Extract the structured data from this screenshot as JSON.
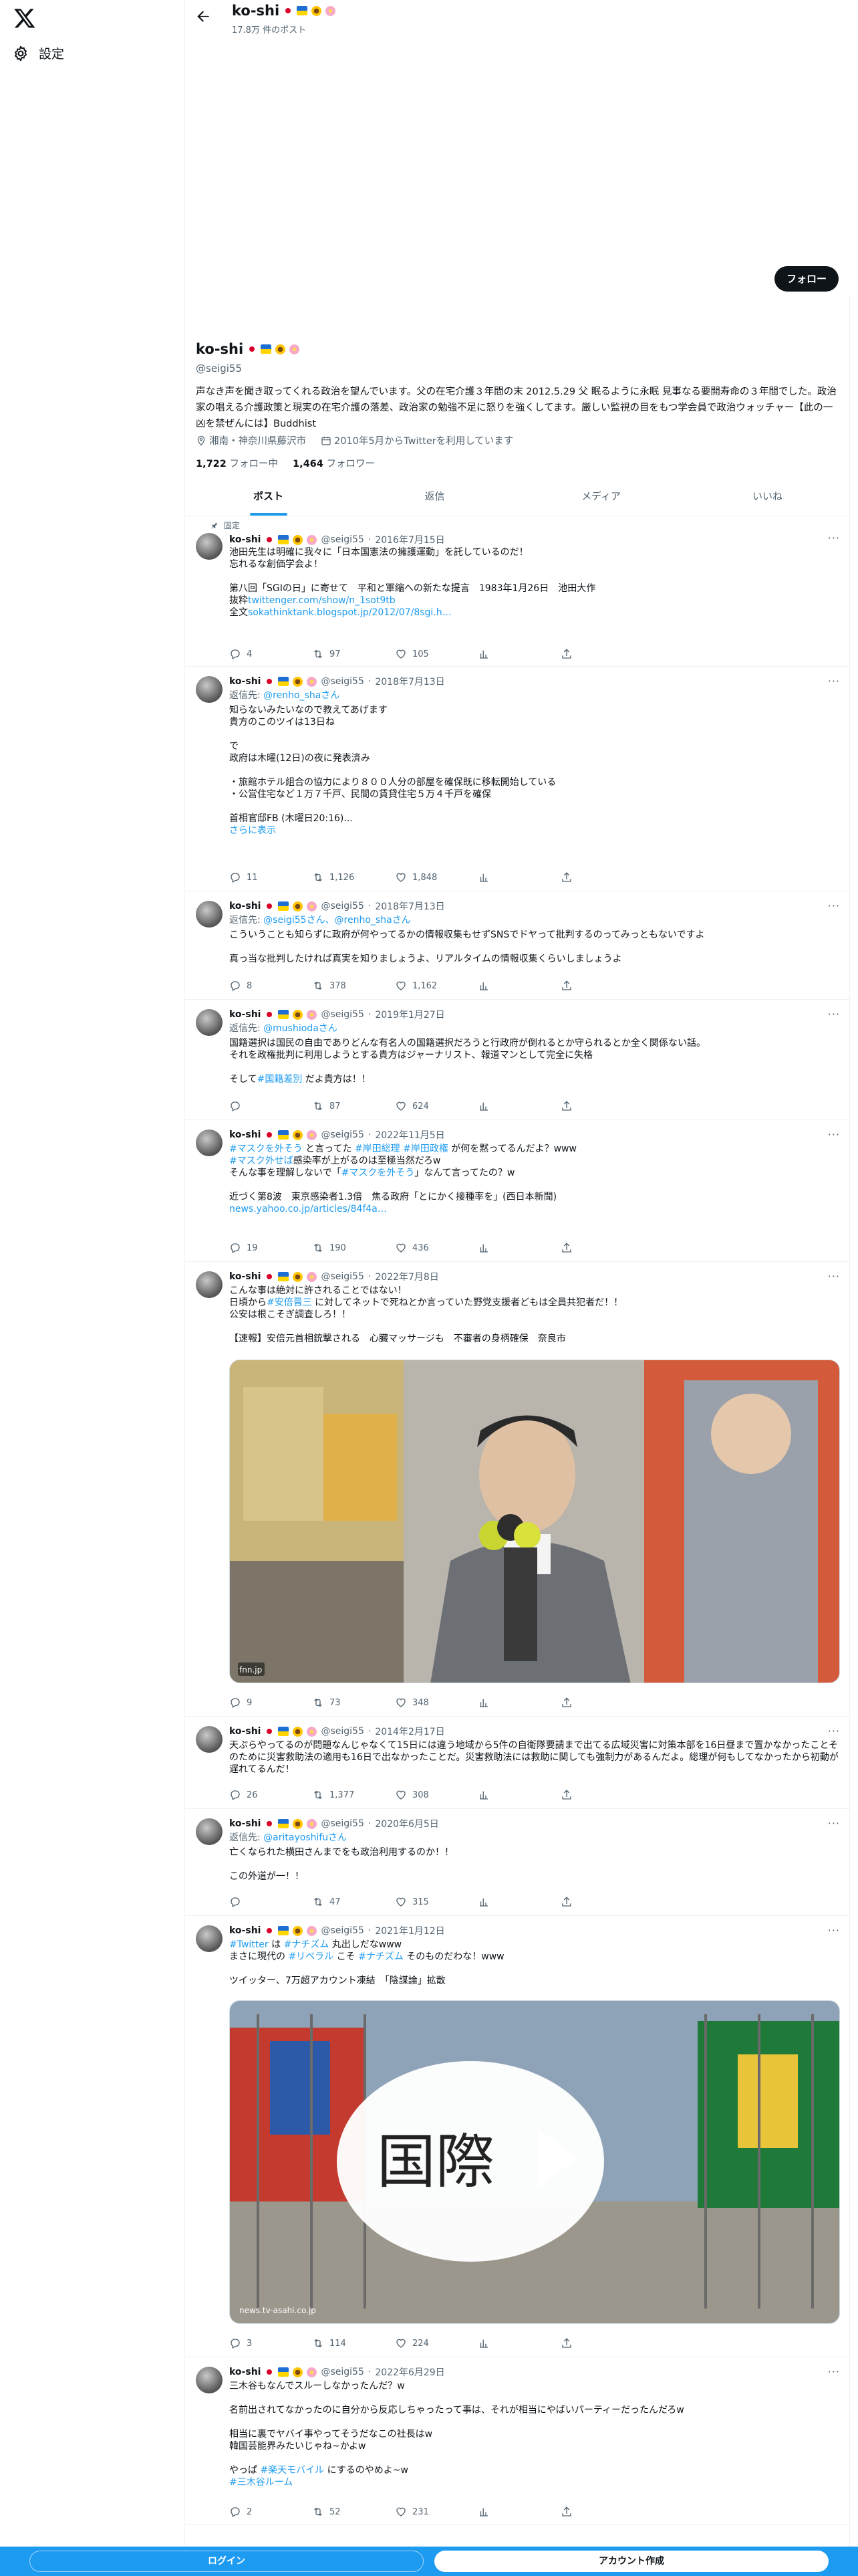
{
  "nav": {
    "settings_label": "設定"
  },
  "header": {
    "name": "ko-shi",
    "post_count": "17.8万 件のポスト"
  },
  "profile": {
    "name": "ko-shi",
    "handle": "@seigi55",
    "follow_label": "フォロー",
    "bio": "声なき声を聞き取ってくれる政治を望んでいます。父の在宅介護３年間の末 2012.5.29 父 眠るように永眠 見事なる要開寿命の３年間でした。政治家の唱える介護政策と現実の在宅介護の落差、政治家の勉強不足に怒りを強くしてます。厳しい監視の目をもつ学会員で政治ウォッチャー【此の一凶を禁ぜんには】Buddhist",
    "location": "湘南・神奈川県藤沢市",
    "joined": "2010年5月からTwitterを利用しています",
    "following_count": "1,722",
    "following_label": "フォロー中",
    "followers_count": "1,464",
    "followers_label": "フォロワー"
  },
  "tabs": [
    "ポスト",
    "返信",
    "メディア",
    "いいね"
  ],
  "tweets": [
    {
      "pinned_label": "固定",
      "name": "ko-shi",
      "handle": "@seigi55",
      "date": "2016年7月15日",
      "reply_to": "",
      "reply_users": "",
      "text": "池田先生は明確に我々に「日本国憲法の擁護運動」を託しているのだ！\n忘れるな創価学会よ！\n\n第八回「SGIの日」に寄せて　平和と軍縮への新たな提言　1983年1月26日　池田大作\n抜粋",
      "links": [
        "twittenger.com/show/n_1sot9tb",
        "全文",
        "sokathinktank.blogspot.jp/2012/07/8sgi.h…"
      ],
      "replies": "4",
      "retweets": "97",
      "likes": "105"
    },
    {
      "name": "ko-shi",
      "handle": "@seigi55",
      "date": "2018年7月13日",
      "reply_to": "返信先: ",
      "reply_users": "@renho_shaさん",
      "text": "知らないみたいなので教えてあげます\n貴方のこのツイは13日ね\n\nで\n政府は木曜(12日)の夜に発表済み\n\n・旅館ホテル組合の協力により８００人分の部屋を確保既に移転開始している\n・公営住宅など１万７千戸、民間の賃貸住宅５万４千戸を確保\n\n首相官邸FB (木曜日20:16)...",
      "more_label": "さらに表示",
      "replies": "11",
      "retweets": "1,126",
      "likes": "1,848"
    },
    {
      "name": "ko-shi",
      "handle": "@seigi55",
      "date": "2018年7月13日",
      "reply_to": "返信先: ",
      "reply_users": "@seigi55さん、@renho_shaさん",
      "text": "こういうことも知らずに政府が何やってるかの情報収集もせずSNSでドヤって批判するのってみっともないですよ\n\n真っ当な批判したければ真実を知りましょうよ、リアルタイムの情報収集くらいしましょうよ",
      "replies": "8",
      "retweets": "378",
      "likes": "1,162"
    },
    {
      "name": "ko-shi",
      "handle": "@seigi55",
      "date": "2019年1月27日",
      "reply_to": "返信先: ",
      "reply_users": "@mushiodaさん",
      "text": "国籍選択は国民の自由でありどんな有名人の国籍選択だろうと行政府が倒れるとか守られるとか全く関係ない話。\nそれを政権批判に利用しようとする貴方はジャーナリスト、報道マンとして完全に失格\n\nそして",
      "hashtag": "#国籍差別",
      "text_after": " だよ貴方は！！",
      "replies": "",
      "retweets": "87",
      "likes": "624"
    },
    {
      "name": "ko-shi",
      "handle": "@seigi55",
      "date": "2022年11月5日",
      "reply_to": "",
      "reply_users": "",
      "text_rich": "#マスクを外そう と言ってた #岸田総理 #岸田政権 が何を黙ってるんだよ？www\n#マスク外せば感染率が上がるのは至極当然だろw\nそんな事を理解しないで「#マスクを外そう」なんて言ってたの？w\n\n近づく第8波　東京感染者1.3倍　焦る政府「とにかく接種率を」(西日本新聞)",
      "line1_tags": "#マスクを外そう",
      "line1_mid": " と言ってた ",
      "line1_tags2": "#岸田総理 #岸田政権",
      "line1_tail": " が何を黙ってるんだよ？www",
      "line2_tag": "#マスク外せば",
      "line2_tail": "感染率が上がるのは至極当然だろw",
      "line3_head": "そんな事を理解しないで「",
      "line3_tag": "#マスクを外そう",
      "line3_tail": "」なんて言ってたの？w",
      "line5": "近づく第8波　東京感染者1.3倍　焦る政府「とにかく接種率を」(西日本新聞)",
      "link": "news.yahoo.co.jp/articles/84f4a…",
      "replies": "19",
      "retweets": "190",
      "likes": "436"
    },
    {
      "name": "ko-shi",
      "handle": "@seigi55",
      "date": "2022年7月8日",
      "reply_to": "",
      "reply_users": "",
      "text_head": "こんな事は絶対に許されることではない！\n日頃から",
      "tag": "#安倍晋三",
      "text_tail": " に対してネットで死ねとか言っていた野党支援者どもは全員共犯者だ！！\n公安は根こそぎ調査しろ！！\n\n【速報】安倍元首相銃撃される　心臓マッサージも　不審者の身柄確保　奈良市",
      "media_source": "fnn.jp",
      "replies": "9",
      "retweets": "73",
      "likes": "348"
    },
    {
      "name": "ko-shi",
      "handle": "@seigi55",
      "date": "2014年2月17日",
      "reply_to": "",
      "reply_users": "",
      "text": "天ぷらやってるのが問題なんじゃなくて15日には違う地域から5件の自衛隊要請まで出てる広域災害に対策本部を16日昼まで置かなかったことそのために災害救助法の適用も16日で出なかったことだ。災害救助法には救助に関しても強制力があるんだよ。総理が何もしてなかったから初動が遅れてるんだ！",
      "replies": "26",
      "retweets": "1,377",
      "likes": "308"
    },
    {
      "name": "ko-shi",
      "handle": "@seigi55",
      "date": "2020年6月5日",
      "reply_to": "返信先: ",
      "reply_users": "@aritayoshifuさん",
      "text": "亡くなられた横田さんまでをも政治利用するのか！！\n\nこの外道が一！！",
      "replies": "",
      "retweets": "47",
      "likes": "315"
    },
    {
      "name": "ko-shi",
      "handle": "@seigi55",
      "date": "2021年1月12日",
      "reply_to": "",
      "reply_users": "",
      "l1_tag1": "#Twitter",
      "l1_mid": " は ",
      "l1_tag2": "#ナチズム",
      "l1_tail": " 丸出しだなwww",
      "l2_head": "まさに現代の ",
      "l2_tag1": "#リベラル",
      "l2_mid": " こそ ",
      "l2_tag2": "#ナチズム",
      "l2_tail": " そのものだわな！www",
      "l4": "ツイッター、7万超アカウント凍結　「陰謀論」拡散",
      "media_text": "国際",
      "media_source": "news.tv-asahi.co.jp",
      "replies": "3",
      "retweets": "114",
      "likes": "224"
    },
    {
      "name": "ko-shi",
      "handle": "@seigi55",
      "date": "2022年6月29日",
      "reply_to": "",
      "reply_users": "",
      "text_head": "三木谷もなんでスルーしなかったんだ？w\n\n名前出されてなかったのに自分から反応しちゃったって事は、それが相当にやばいパーティーだったんだろw\n\n相当に裏でヤバイ事やってそうだなこの社長はw\n韓国芸能界みたいじゃね~かよw\n\nやっぱ ",
      "tag1": "#楽天モバイル",
      "text_mid": " にするのやめよ~w\n",
      "tag2": "#三木谷ルーム",
      "replies": "2",
      "retweets": "52",
      "likes": "231"
    }
  ],
  "bottom": {
    "login_label": "ログイン",
    "signup_label": "アカウント作成"
  }
}
